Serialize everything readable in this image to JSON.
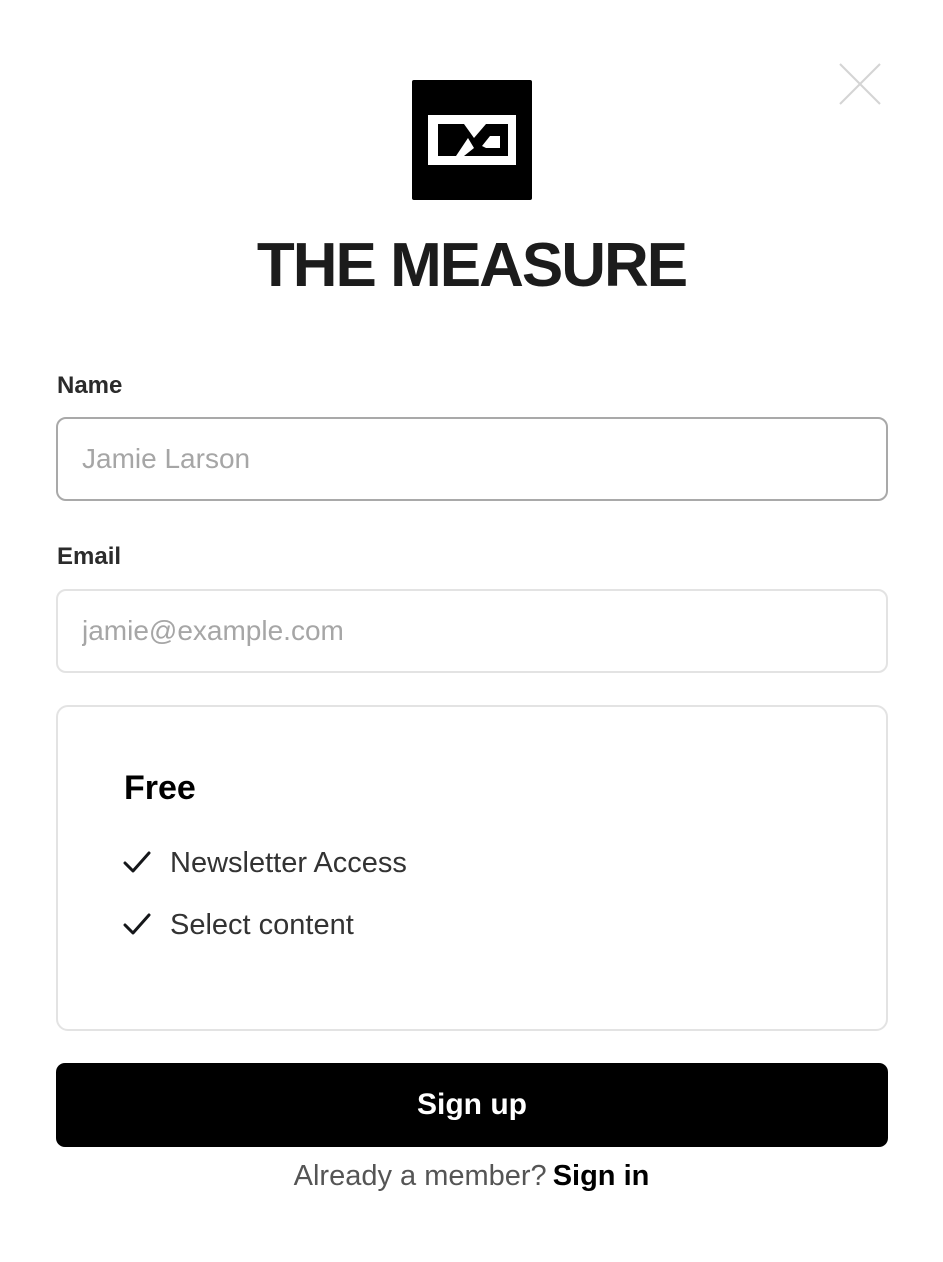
{
  "header": {
    "close_icon": "close-icon",
    "logo_icon": "the-measure-logo",
    "site_title": "THE MEASURE"
  },
  "form": {
    "name_label": "Name",
    "name_placeholder": "Jamie Larson",
    "name_value": "",
    "email_label": "Email",
    "email_placeholder": "jamie@example.com",
    "email_value": ""
  },
  "plan": {
    "name": "Free",
    "benefits": [
      {
        "icon": "check-icon",
        "text": "Newsletter Access"
      },
      {
        "icon": "check-icon",
        "text": "Select content"
      }
    ]
  },
  "actions": {
    "signup_label": "Sign up",
    "already_member_text": "Already a member?",
    "signin_label": "Sign in"
  },
  "colors": {
    "primary": "#000000",
    "background": "#ffffff",
    "border_focus": "#a9a9a9",
    "border_default": "#e3e3e3"
  }
}
